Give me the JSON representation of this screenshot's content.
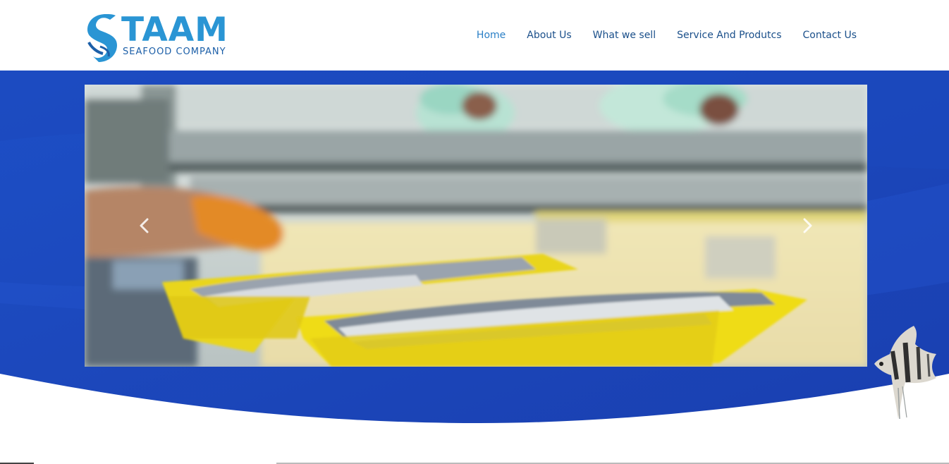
{
  "brand": {
    "name": "TAAM",
    "tagline": "SEAFOOD COMPANY",
    "color_primary": "#2a95d4",
    "color_secondary": "#1c5fa8"
  },
  "nav": {
    "items": [
      {
        "label": "Home",
        "active": true
      },
      {
        "label": "About Us",
        "active": false
      },
      {
        "label": "What we sell",
        "active": false
      },
      {
        "label": "Service And Produtcs",
        "active": false
      },
      {
        "label": "Contact Us",
        "active": false
      }
    ]
  },
  "hero": {
    "background_color": "#1c4fc4",
    "slider": {
      "image_icon": "fish-processing-line-photo",
      "prev_icon": "chevron-left-icon",
      "next_icon": "chevron-right-icon"
    },
    "decoration_icon": "angelfish-icon"
  }
}
